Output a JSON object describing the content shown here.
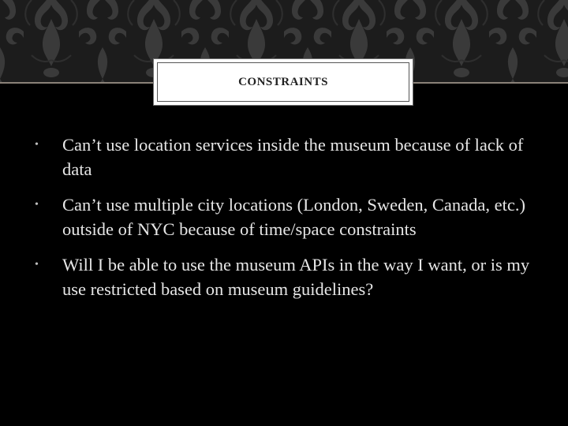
{
  "slide": {
    "title": "CONSTRAINTS",
    "bullets": [
      {
        "marker": "•",
        "text": "Can’t use location services inside the museum because of lack of data"
      },
      {
        "marker": "•",
        "text": "Can’t use multiple city locations (London, Sweden, Canada, etc.) outside of NYC because of time/space constraints"
      },
      {
        "marker": "•",
        "text": "Will I be able to use the museum APIs in the way I want, or is my use restricted based on museum guidelines?"
      }
    ]
  },
  "colors": {
    "background": "#000000",
    "header_band": "#1c1c1c",
    "damask_pattern": "#3a3a3a",
    "rule": "#8a8178",
    "title_box": "#ffffff",
    "title_text": "#222222",
    "body_text": "#e6e6e6"
  },
  "decorations": {
    "header_pattern": "damask-pattern"
  }
}
